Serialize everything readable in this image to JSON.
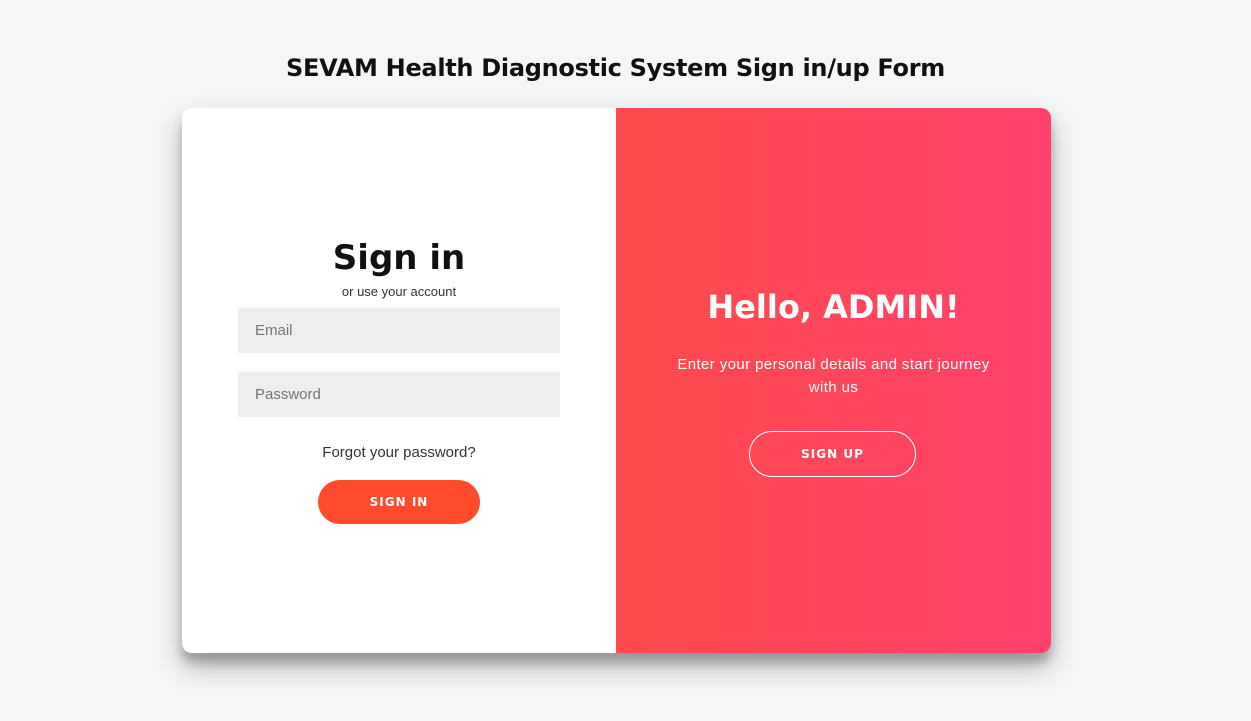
{
  "page": {
    "title": "SEVAM Health Diagnostic System Sign in/up Form"
  },
  "sign_in": {
    "heading": "Sign in",
    "subtext": "or use your account",
    "email_placeholder": "Email",
    "password_placeholder": "Password",
    "forgot_link": "Forgot your password?",
    "button_label": "SIGN IN"
  },
  "overlay": {
    "heading": "Hello, ADMIN!",
    "text": "Enter your personal details and start journey with us",
    "button_label": "SIGN UP"
  },
  "colors": {
    "background": "#f5f6f8",
    "signin_button": "#ff4b2b",
    "overlay_gradient_start": "#ff4b4b",
    "overlay_gradient_end": "#ff416c",
    "input_background": "#eeeeee"
  }
}
